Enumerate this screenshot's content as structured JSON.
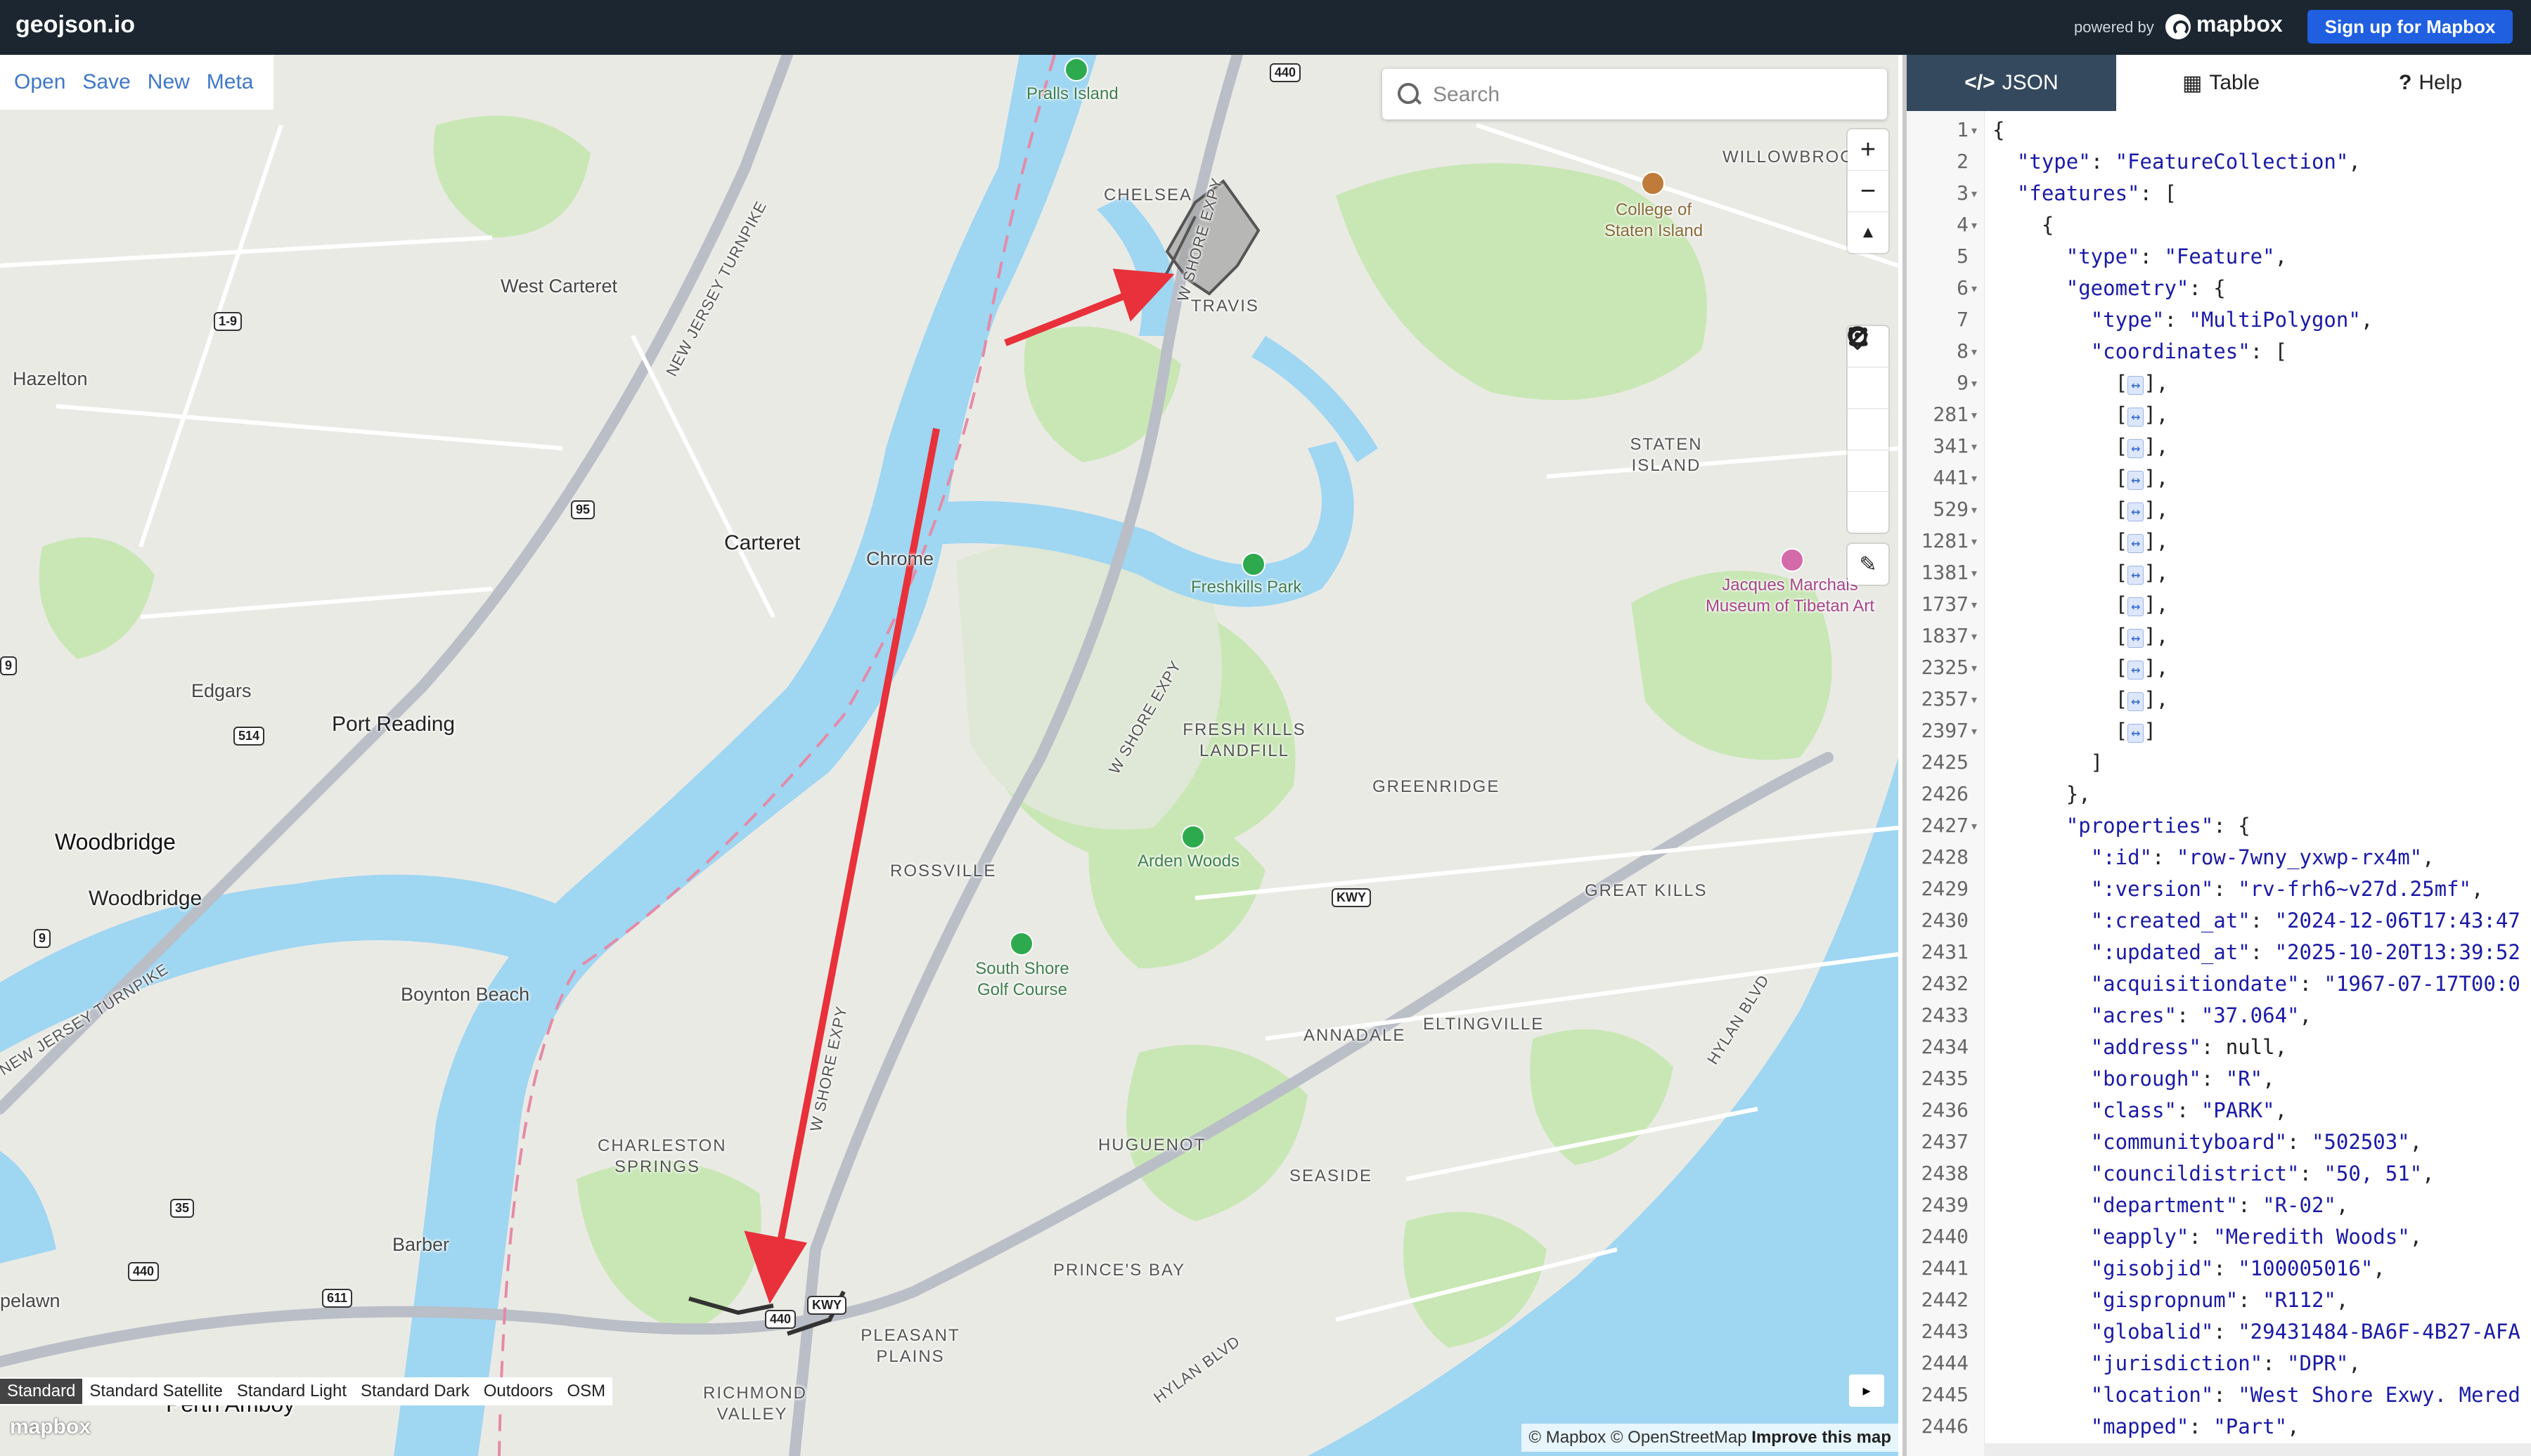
{
  "app": {
    "brand": "geojson.io",
    "powered_by": "powered by",
    "mapbox_word": "mapbox",
    "signup_label": "Sign up for Mapbox"
  },
  "file_menu": [
    "Open",
    "Save",
    "New",
    "Meta"
  ],
  "search": {
    "placeholder": "Search"
  },
  "map_controls": {
    "zoom_in": "+",
    "zoom_out": "−",
    "compass": "▲",
    "draw_tools": [
      "marker",
      "line",
      "polygon",
      "rectangle",
      "circle"
    ],
    "edit": "✎"
  },
  "map_labels": {
    "towns": [
      "West Carteret",
      "Hazelton",
      "Edgars",
      "Boynton Beach",
      "Barber",
      "pelawn"
    ],
    "cities": [
      "Carteret",
      "Port Reading",
      "Woodbridge"
    ],
    "big_cities": [
      "Woodbridge",
      "Perth Amboy"
    ],
    "chrome": "Chrome",
    "neighborhoods": [
      "WILLOWBROOK",
      "CHELSEA",
      "TRAVIS",
      "STATEN ISLAND",
      "FRESH KILLS LANDFILL",
      "GREENRIDGE",
      "ROSSVILLE",
      "GREAT KILLS",
      "ANNADALE",
      "ELTINGVILLE",
      "CHARLESTON SPRINGS",
      "HUGUENOT",
      "SEASIDE",
      "PRINCE'S BAY",
      "PLEASANT PLAINS",
      "RICHMOND VALLEY"
    ],
    "parks": [
      "Pralls Island",
      "Freshkills Park",
      "Arden Woods",
      "South Shore Golf Course"
    ],
    "pois": [
      "College of Staten Island",
      "Jacques Marchais Museum of Tibetan Art"
    ],
    "roads": [
      "NEW JERSEY TURNPIKE",
      "NEW JERSEY TURNPIKE",
      "W SHORE EXPY",
      "W SHORE EXPY",
      "W SHORE EXPY",
      "HYLAN BLVD",
      "HYLAN BLVD"
    ],
    "shields": [
      "440",
      "1-9",
      "95",
      "514",
      "9",
      "35",
      "440",
      "611",
      "440",
      "KWY",
      "KWY",
      "9"
    ]
  },
  "map_styles": [
    "Standard",
    "Standard Satellite",
    "Standard Light",
    "Standard Dark",
    "Outdoors",
    "OSM"
  ],
  "map_styles_active": "Standard",
  "attribution": {
    "mapbox": "© Mapbox",
    "osm": "© OpenStreetMap",
    "improve": "Improve this map"
  },
  "map_logo": "mapbox",
  "tabs": [
    {
      "label": "JSON",
      "icon": "</>"
    },
    {
      "label": "Table",
      "icon": "▦"
    },
    {
      "label": "Help",
      "icon": "?"
    }
  ],
  "editor": {
    "lines": [
      {
        "n": "1",
        "fold": true,
        "text": "{"
      },
      {
        "n": "2",
        "fold": false,
        "text": "  \"type\": \"FeatureCollection\","
      },
      {
        "n": "3",
        "fold": true,
        "text": "  \"features\": ["
      },
      {
        "n": "4",
        "fold": true,
        "text": "    {"
      },
      {
        "n": "5",
        "fold": false,
        "text": "      \"type\": \"Feature\","
      },
      {
        "n": "6",
        "fold": true,
        "text": "      \"geometry\": {"
      },
      {
        "n": "7",
        "fold": false,
        "text": "        \"type\": \"MultiPolygon\","
      },
      {
        "n": "8",
        "fold": true,
        "text": "        \"coordinates\": ["
      },
      {
        "n": "9",
        "fold": true,
        "text": "          [↔],"
      },
      {
        "n": "281",
        "fold": true,
        "text": "          [↔],"
      },
      {
        "n": "341",
        "fold": true,
        "text": "          [↔],"
      },
      {
        "n": "441",
        "fold": true,
        "text": "          [↔],"
      },
      {
        "n": "529",
        "fold": true,
        "text": "          [↔],"
      },
      {
        "n": "1281",
        "fold": true,
        "text": "          [↔],"
      },
      {
        "n": "1381",
        "fold": true,
        "text": "          [↔],"
      },
      {
        "n": "1737",
        "fold": true,
        "text": "          [↔],"
      },
      {
        "n": "1837",
        "fold": true,
        "text": "          [↔],"
      },
      {
        "n": "2325",
        "fold": true,
        "text": "          [↔],"
      },
      {
        "n": "2357",
        "fold": true,
        "text": "          [↔],"
      },
      {
        "n": "2397",
        "fold": true,
        "text": "          [↔]"
      },
      {
        "n": "2425",
        "fold": false,
        "text": "        ]"
      },
      {
        "n": "2426",
        "fold": false,
        "text": "      },"
      },
      {
        "n": "2427",
        "fold": true,
        "text": "      \"properties\": {"
      },
      {
        "n": "2428",
        "fold": false,
        "text": "        \":id\": \"row-7wny_yxwp-rx4m\","
      },
      {
        "n": "2429",
        "fold": false,
        "text": "        \":version\": \"rv-frh6~v27d.25mf\","
      },
      {
        "n": "2430",
        "fold": false,
        "text": "        \":created_at\": \"2024-12-06T17:43:47"
      },
      {
        "n": "2431",
        "fold": false,
        "text": "        \":updated_at\": \"2025-10-20T13:39:52"
      },
      {
        "n": "2432",
        "fold": false,
        "text": "        \"acquisitiondate\": \"1967-07-17T00:0"
      },
      {
        "n": "2433",
        "fold": false,
        "text": "        \"acres\": \"37.064\","
      },
      {
        "n": "2434",
        "fold": false,
        "text": "        \"address\": null,"
      },
      {
        "n": "2435",
        "fold": false,
        "text": "        \"borough\": \"R\","
      },
      {
        "n": "2436",
        "fold": false,
        "text": "        \"class\": \"PARK\","
      },
      {
        "n": "2437",
        "fold": false,
        "text": "        \"communityboard\": \"502503\","
      },
      {
        "n": "2438",
        "fold": false,
        "text": "        \"councildistrict\": \"50, 51\","
      },
      {
        "n": "2439",
        "fold": false,
        "text": "        \"department\": \"R-02\","
      },
      {
        "n": "2440",
        "fold": false,
        "text": "        \"eapply\": \"Meredith Woods\","
      },
      {
        "n": "2441",
        "fold": false,
        "text": "        \"gisobjid\": \"100005016\","
      },
      {
        "n": "2442",
        "fold": false,
        "text": "        \"gispropnum\": \"R112\","
      },
      {
        "n": "2443",
        "fold": false,
        "text": "        \"globalid\": \"29431484-BA6F-4B27-AFA"
      },
      {
        "n": "2444",
        "fold": false,
        "text": "        \"jurisdiction\": \"DPR\","
      },
      {
        "n": "2445",
        "fold": false,
        "text": "        \"location\": \"West Shore Exwy. Mered"
      },
      {
        "n": "2446",
        "fold": false,
        "text": "        \"mapped\": \"Part\","
      }
    ]
  },
  "colors": {
    "topbar": "#1b2631",
    "signup": "#1f5fe0",
    "active_tab": "#34495e",
    "water": "#9fd6f2",
    "park": "#c9e7b5",
    "annotation_arrow": "#e8313a",
    "feature_polygon": "#8c8c8c"
  }
}
